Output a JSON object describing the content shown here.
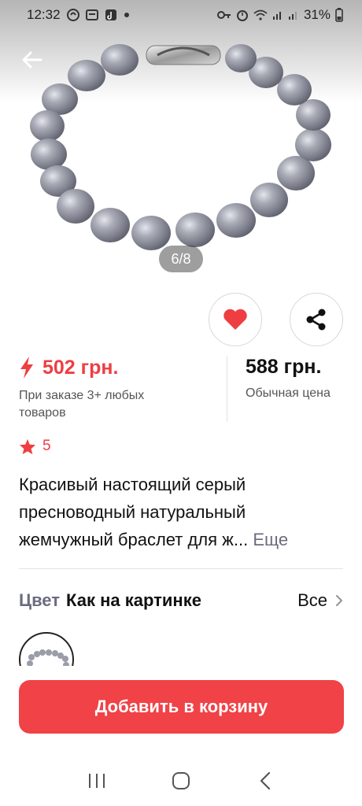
{
  "status": {
    "time": "12:32",
    "battery": "31%",
    "icons": [
      "app-notification-icon",
      "message-icon",
      "tiktok-icon",
      "dot-icon",
      "key-icon",
      "alarm-icon",
      "wifi-icon",
      "signal-icon",
      "signal-icon",
      "battery-icon"
    ]
  },
  "gallery": {
    "pager": "6/8",
    "icons": {
      "back": "back-arrow-icon"
    }
  },
  "actions": {
    "favorite_icon": "heart-icon",
    "share_icon": "share-icon"
  },
  "price": {
    "promo_value": "502 грн.",
    "promo_note": "При заказе 3+ любых товаров",
    "regular_value": "588 грн.",
    "regular_note": "Обычная цена",
    "promo_icon": "lightning-icon"
  },
  "rating": {
    "value": "5",
    "icon": "star-icon"
  },
  "description": {
    "text": "Красивый настоящий серый пресноводный натуральный жемчужный браслет для ж...",
    "more": " Еще"
  },
  "color": {
    "label": "Цвет",
    "value": "Как на картинке",
    "all": "Все"
  },
  "cart": {
    "label": "Добавить в корзину"
  },
  "colors": {
    "accent": "#ef3e42",
    "muted": "#6b6b80"
  }
}
